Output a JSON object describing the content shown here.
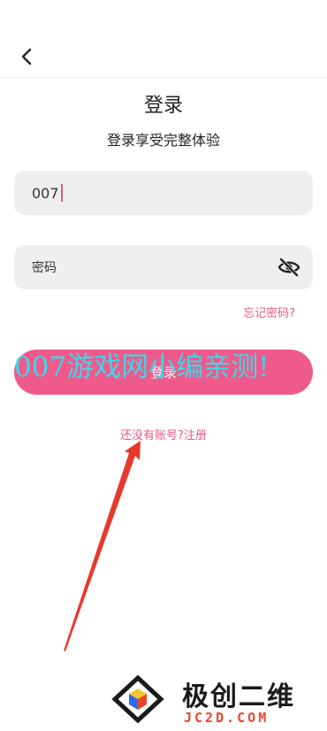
{
  "header": {
    "back_icon": "chevron-left-icon"
  },
  "main": {
    "title": "登录",
    "subtitle": "登录享受完整体验",
    "account_field": {
      "value": "007"
    },
    "password_field": {
      "placeholder": "密码",
      "toggle_icon": "eye-off-icon"
    },
    "forgot_password": "忘记密码?",
    "login_button": "登录",
    "register_link": "还没有账号?注册"
  },
  "overlay": {
    "watermark": "007游戏网小编亲测!",
    "brand_name": "极创二维",
    "brand_domain": "JC2D.COM",
    "colors": {
      "accent": "#ef5a8c",
      "watermark": "#3bd8e6",
      "arrow": "#e8382c"
    }
  }
}
